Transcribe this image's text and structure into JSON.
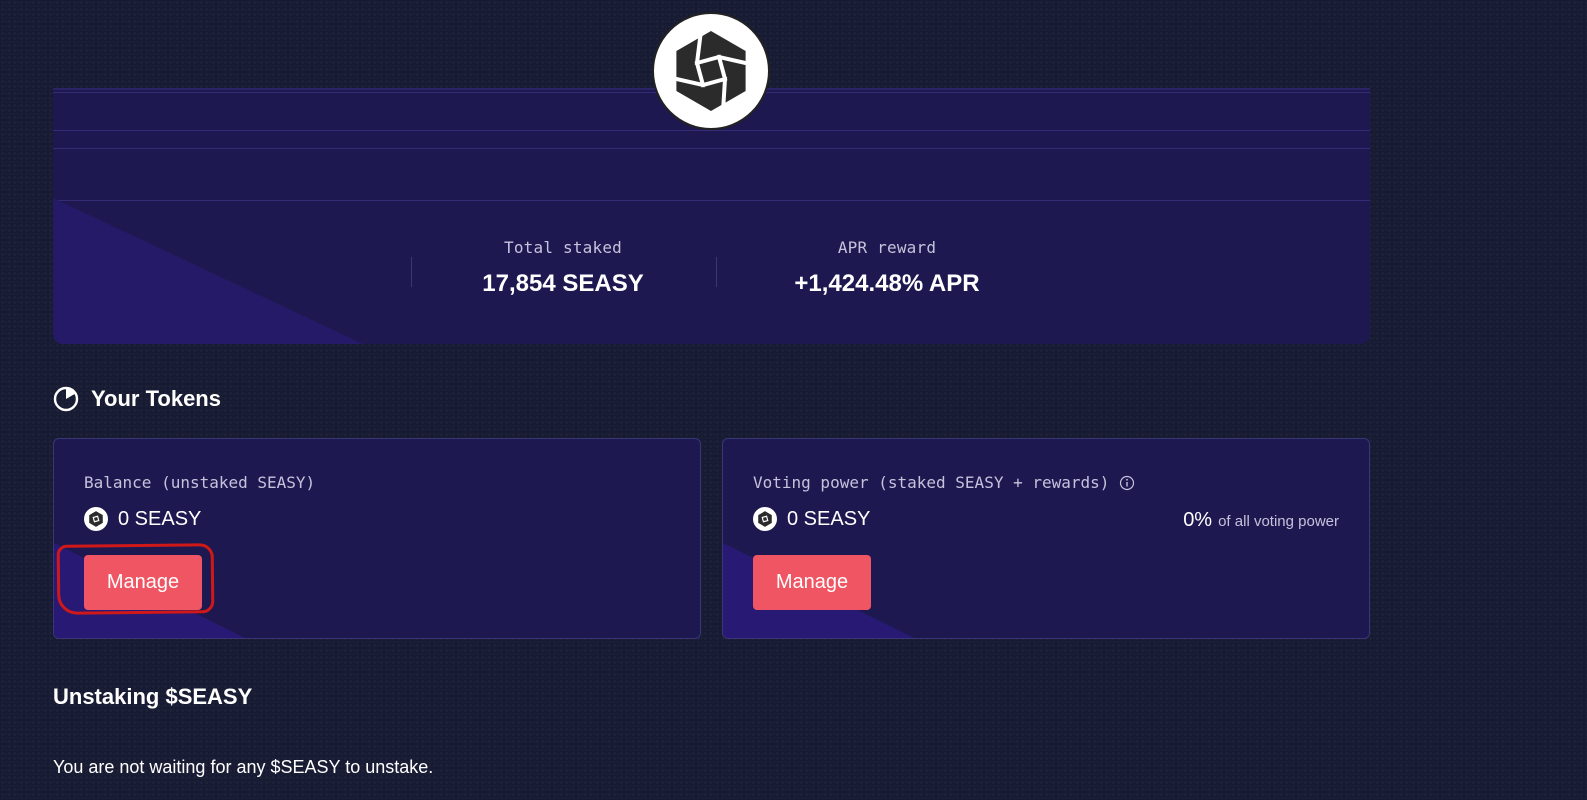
{
  "stats": {
    "total_staked": {
      "label": "Total staked",
      "value": "17,854 SEASY"
    },
    "apr_reward": {
      "label": "APR reward",
      "value": "+1,424.48% APR"
    }
  },
  "logo": {
    "icon": "seasy-logo-icon"
  },
  "tokens_section": {
    "title": "Your Tokens",
    "icon": "pie-chart-icon"
  },
  "balance_card": {
    "label": "Balance (unstaked SEASY)",
    "amount": "0 SEASY",
    "button_label": "Manage"
  },
  "voting_card": {
    "label": "Voting power (staked SEASY + rewards)",
    "info_icon": "info-icon",
    "amount": "0 SEASY",
    "percent": "0%",
    "percent_caption": "of all voting power",
    "button_label": "Manage"
  },
  "unstaking": {
    "title": "Unstaking $SEASY",
    "message": "You are not waiting for any $SEASY to unstake."
  },
  "colors": {
    "background": "#1a1d36",
    "panel": "#1e1850",
    "accent_button": "#ef5562",
    "annotation": "#d01818"
  }
}
